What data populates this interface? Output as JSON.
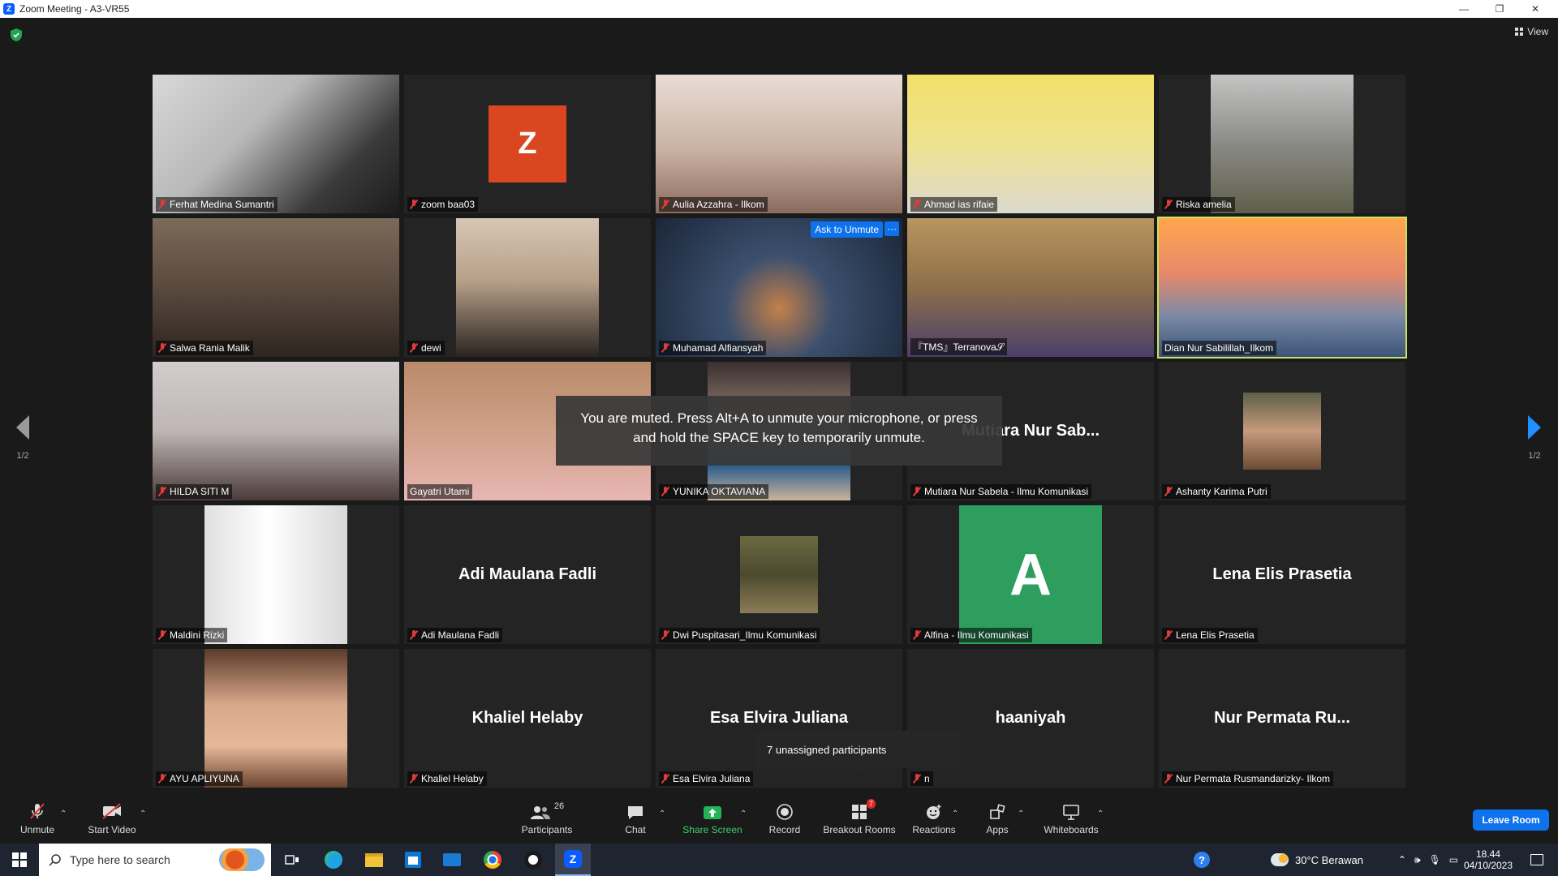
{
  "window": {
    "title": "Zoom Meeting - A3-VR55",
    "minimize": "—",
    "restore": "❐",
    "close": "✕"
  },
  "view_label": "View",
  "pager": {
    "left": "1/2",
    "right": "1/2"
  },
  "tiles": [
    {
      "name": "Ferhat Medina Sumantri",
      "type": "video",
      "bg": "linear-gradient(135deg,#d8d8d8 0%,#b8b8b8 40%,#3a3a3a 75%,#1c1c1c 100%)"
    },
    {
      "name": "zoom baa03",
      "type": "letter",
      "letter": "Z",
      "color": "#d9461f"
    },
    {
      "name": "Aulia Azzahra - Ilkom",
      "type": "video",
      "bg": "linear-gradient(180deg,#e9ddd5 0%,#c9b1a2 55%,#8a6b5d 100%)"
    },
    {
      "name": "Ahmad ias rifaie",
      "type": "video",
      "bg": "linear-gradient(180deg,#f2e06a 0%,#efe28f 50%,#dcd9cf 100%)"
    },
    {
      "name": "Riska amelia",
      "type": "narrow",
      "bg": "linear-gradient(180deg,#c4c4c4 0%,#8a8a86 50%,#5f5f4a 100%)"
    },
    {
      "name": "Salwa Rania Malik",
      "type": "video",
      "bg": "linear-gradient(180deg,#7c6a5a 0%,#5a4a3e 50%,#2d2520 100%)"
    },
    {
      "name": "dewi",
      "type": "narrow",
      "bg": "linear-gradient(180deg,#d6c6b4 0%,#b8a08a 45%,#2a2420 100%)"
    },
    {
      "name": "Muhamad Alfiansyah",
      "type": "video",
      "bg": "radial-gradient(circle at 50% 65%,#c4804a 0%,#3b4f6d 35%,#1b2638 100%)",
      "ask": "Ask to Unmute",
      "more": "···"
    },
    {
      "name": "『TMS』Terranova𝒮",
      "type": "video",
      "muted": false,
      "bg": "linear-gradient(180deg,#b9955e 0%,#8d6f4a 50%,#4b3f6b 100%)"
    },
    {
      "name": "Dian Nur Sabilillah_Ilkom",
      "type": "video",
      "muted": false,
      "active": true,
      "bg": "linear-gradient(180deg,#ffa64d 0%,#e8886a 40%,#7d8aa6 70%,#3a5478 100%)"
    },
    {
      "name": "HILDA SITI M",
      "type": "video",
      "bg": "linear-gradient(180deg,#d2cccc 0%,#bfb6b6 50%,#4b3a3a 100%)"
    },
    {
      "name": "Gayatri Utami",
      "type": "video",
      "muted": false,
      "bg": "linear-gradient(180deg,#b98a6a 0%,#d0a088 50%,#e8b6b4 100%)"
    },
    {
      "name": "YUNIKA OKTAVIANA",
      "type": "narrow",
      "bg": "linear-gradient(180deg,#3a3030 0%,#8d7b6e 40%,#2d5d8c 75%,#c9b59b 100%)"
    },
    {
      "name": "Mutiara Nur Sabela - Ilmu Komunikasi",
      "type": "bigname",
      "big": "Mutiara Nur Sab..."
    },
    {
      "name": "Ashanty Karima Putri",
      "type": "thumb",
      "bg": "linear-gradient(180deg,#5d5f48 0%,#c79b7c 50%,#6b4a34 100%)"
    },
    {
      "name": "Maldini Rizki",
      "type": "narrow",
      "bg": "linear-gradient(90deg,#e0e0e0 0%,#ffffff 45%,#d8d8d8 100%)"
    },
    {
      "name": "Adi Maulana Fadli",
      "type": "bigname",
      "big": "Adi Maulana Fadli"
    },
    {
      "name": "Dwi Puspitasari_Ilmu Komunikasi",
      "type": "thumb",
      "bg": "linear-gradient(180deg,#6b6a40 0%,#4d4a2f 50%,#8a7b55 100%)"
    },
    {
      "name": "Alfina - Ilmu Komunikasi",
      "type": "letter",
      "letter": "A",
      "color": "#2e9e5e",
      "wide": true
    },
    {
      "name": "Lena Elis Prasetia",
      "type": "bigname",
      "big": "Lena Elis Prasetia"
    },
    {
      "name": "AYU APLIYUNA",
      "type": "narrow",
      "bg": "linear-gradient(180deg,#5a3a2a 0%,#d9a88a 40%,#e6b89a 70%,#6b4530 100%)"
    },
    {
      "name": "Khaliel Helaby",
      "type": "bigname",
      "big": "Khaliel Helaby"
    },
    {
      "name": "Esa Elvira Juliana",
      "type": "bigname",
      "big": "Esa Elvira Juliana"
    },
    {
      "name": "n",
      "type": "bigname",
      "big": "haaniyah"
    },
    {
      "name": "Nur Permata Rusmandarizky- Ilkom",
      "type": "bigname",
      "big": "Nur Permata Ru..."
    }
  ],
  "toast": "You are muted. Press Alt+A to unmute your microphone, or press and hold the SPACE key to temporarily unmute.",
  "breakout_tip": "7 unassigned participants",
  "toolbar": {
    "unmute": "Unmute",
    "start_video": "Start Video",
    "participants": "Participants",
    "participants_count": "26",
    "chat": "Chat",
    "share_screen": "Share Screen",
    "record": "Record",
    "breakout_rooms": "Breakout Rooms",
    "breakout_count": "7",
    "reactions": "Reactions",
    "apps": "Apps",
    "whiteboards": "Whiteboards",
    "leave": "Leave Room"
  },
  "taskbar": {
    "search_placeholder": "Type here to search",
    "weather": "30°C  Berawan",
    "time": "18.44",
    "date": "04/10/2023"
  }
}
